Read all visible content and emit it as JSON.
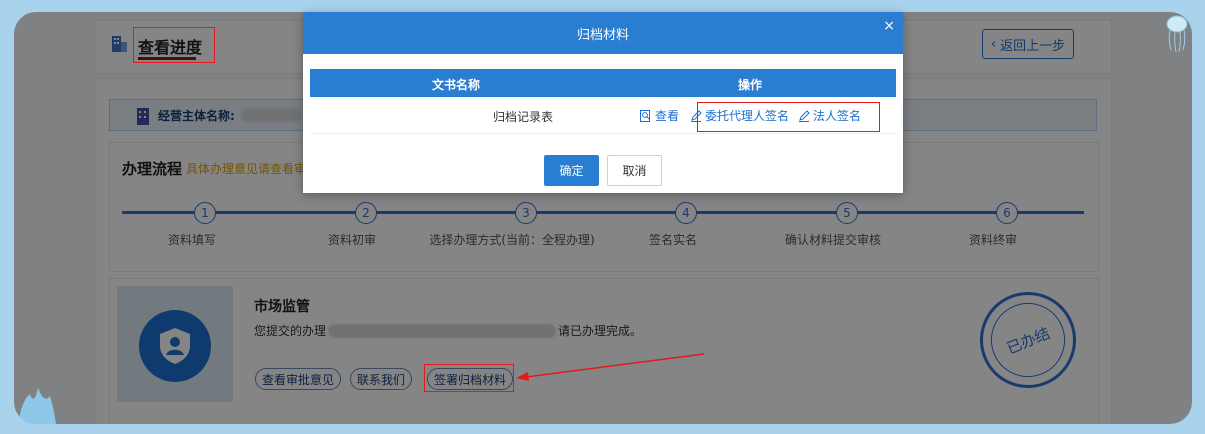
{
  "header": {
    "title": "查看进度",
    "back_label": "返回上一步"
  },
  "entity": {
    "label": "经营主体名称:"
  },
  "process": {
    "title": "办理流程",
    "note": "具体办理意见请查看审",
    "steps": [
      {
        "number": "1",
        "label": "资料填写"
      },
      {
        "number": "2",
        "label": "资料初审"
      },
      {
        "number": "3",
        "label": "选择办理方式(当前：全程办理)"
      },
      {
        "number": "4",
        "label": "签名实名"
      },
      {
        "number": "5",
        "label": "确认材料提交审核"
      },
      {
        "number": "6",
        "label": "资料终审"
      }
    ]
  },
  "card": {
    "title": "市场监管",
    "text_prefix": "您提交的办理",
    "text_suffix": "请已办理完成。",
    "buttons": {
      "approval": "查看审批意见",
      "contact": "联系我们",
      "sign_archive": "签署归档材料"
    },
    "stamp_text": "已办结"
  },
  "modal": {
    "title": "归档材料",
    "close": "×",
    "columns": {
      "doc": "文书名称",
      "ops": "操作"
    },
    "rows": [
      {
        "doc": "归档记录表",
        "view": "查看",
        "agent_sign": "委托代理人签名",
        "legal_sign": "法人签名"
      }
    ],
    "ok": "确定",
    "cancel": "取消"
  },
  "colors": {
    "primary": "#2a7ed2",
    "annotation": "#e3191d",
    "warning": "#e0a300"
  }
}
